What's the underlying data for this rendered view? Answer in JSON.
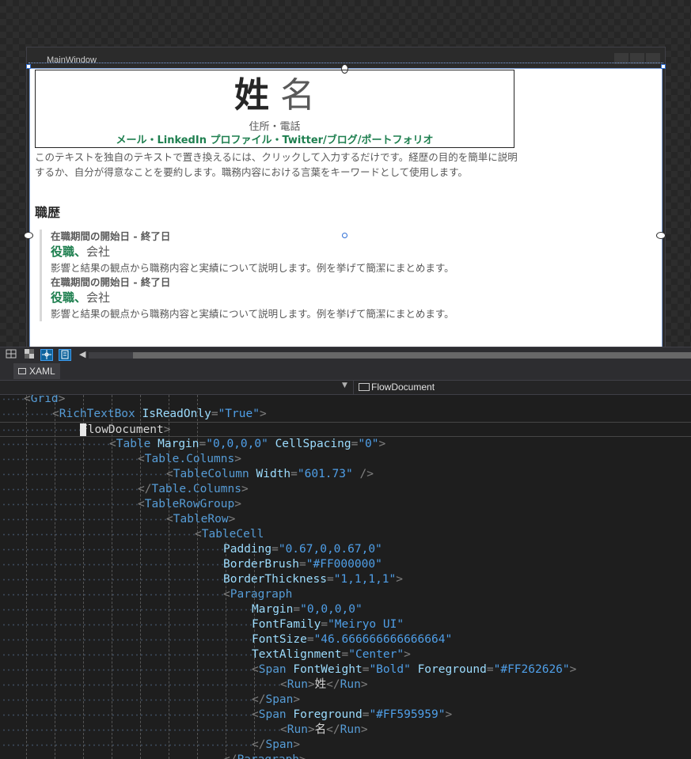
{
  "designer": {
    "window_title": "MainWindow",
    "last_name": "姓",
    "first_name": "名",
    "address": "住所・電話",
    "contact": "メール・LinkedIn プロファイル・Twitter/ブログ/ポートフォリオ",
    "summary": "このテキストを独自のテキストで置き換えるには、クリックして入力するだけです。経歴の目的を簡単に説明するか、自分が得意なことを要約します。職務内容における言葉をキーワードとして使用します。",
    "section_heading": "職歴",
    "jobs": [
      {
        "dates": "在職期間の開始日 - 終了日",
        "role": "役職、",
        "company": "会社",
        "description": "影響と結果の観点から職務内容と実績について説明します。例を挙げて簡潔にまとめます。"
      },
      {
        "dates": "在職期間の開始日 - 終了日",
        "role": "役職、",
        "company": "会社",
        "description": "影響と結果の観点から職務内容と実績について説明します。例を挙げて簡潔にまとめます。"
      }
    ],
    "colors": {
      "name_bold": "#262626",
      "name_light": "#595959",
      "accent_green": "#1e7f4f"
    }
  },
  "zoombar": {
    "icons": [
      "grid-toggle-icon",
      "checker-background-icon",
      "snap-lines-icon",
      "snap-grid-icon"
    ]
  },
  "tabs": {
    "xaml_label": "XAML"
  },
  "navbar": {
    "element_label": "FlowDocument"
  },
  "editor": {
    "lines": [
      {
        "indent": 1,
        "tokens": [
          [
            "p",
            "<"
          ],
          [
            "t",
            "Grid"
          ],
          [
            "p",
            ">"
          ]
        ]
      },
      {
        "indent": 2,
        "tokens": [
          [
            "p",
            "<"
          ],
          [
            "t",
            "RichTextBox"
          ],
          [
            "x",
            " "
          ],
          [
            "a",
            "IsReadOnly"
          ],
          [
            "p",
            "="
          ],
          [
            "v",
            "\"True\""
          ],
          [
            "p",
            ">"
          ]
        ]
      },
      {
        "indent": 3,
        "tokens": [
          [
            "x",
            "FlowDocument"
          ],
          [
            "p",
            ">"
          ]
        ]
      },
      {
        "indent": 4,
        "tokens": [
          [
            "p",
            "<"
          ],
          [
            "t",
            "Table"
          ],
          [
            "x",
            " "
          ],
          [
            "a",
            "Margin"
          ],
          [
            "p",
            "="
          ],
          [
            "v",
            "\"0,0,0,0\""
          ],
          [
            "x",
            " "
          ],
          [
            "a",
            "CellSpacing"
          ],
          [
            "p",
            "="
          ],
          [
            "v",
            "\"0\""
          ],
          [
            "p",
            ">"
          ]
        ]
      },
      {
        "indent": 5,
        "tokens": [
          [
            "p",
            "<"
          ],
          [
            "t",
            "Table.Columns"
          ],
          [
            "p",
            ">"
          ]
        ]
      },
      {
        "indent": 6,
        "tokens": [
          [
            "p",
            "<"
          ],
          [
            "t",
            "TableColumn"
          ],
          [
            "x",
            " "
          ],
          [
            "a",
            "Width"
          ],
          [
            "p",
            "="
          ],
          [
            "v",
            "\"601.73\""
          ],
          [
            "x",
            " "
          ],
          [
            "p",
            "/>"
          ]
        ]
      },
      {
        "indent": 5,
        "tokens": [
          [
            "p",
            "</"
          ],
          [
            "t",
            "Table.Columns"
          ],
          [
            "p",
            ">"
          ]
        ]
      },
      {
        "indent": 5,
        "tokens": [
          [
            "p",
            "<"
          ],
          [
            "t",
            "TableRowGroup"
          ],
          [
            "p",
            ">"
          ]
        ]
      },
      {
        "indent": 6,
        "tokens": [
          [
            "p",
            "<"
          ],
          [
            "t",
            "TableRow"
          ],
          [
            "p",
            ">"
          ]
        ]
      },
      {
        "indent": 7,
        "tokens": [
          [
            "p",
            "<"
          ],
          [
            "t",
            "TableCell"
          ]
        ]
      },
      {
        "indent": 8,
        "tokens": [
          [
            "a",
            "Padding"
          ],
          [
            "p",
            "="
          ],
          [
            "v",
            "\"0.67,0,0.67,0\""
          ]
        ]
      },
      {
        "indent": 8,
        "tokens": [
          [
            "a",
            "BorderBrush"
          ],
          [
            "p",
            "="
          ],
          [
            "v",
            "\"#FF000000\""
          ]
        ]
      },
      {
        "indent": 8,
        "tokens": [
          [
            "a",
            "BorderThickness"
          ],
          [
            "p",
            "="
          ],
          [
            "v",
            "\"1,1,1,1\""
          ],
          [
            "p",
            ">"
          ]
        ]
      },
      {
        "indent": 8,
        "tokens": [
          [
            "p",
            "<"
          ],
          [
            "t",
            "Paragraph"
          ]
        ]
      },
      {
        "indent": 9,
        "tokens": [
          [
            "a",
            "Margin"
          ],
          [
            "p",
            "="
          ],
          [
            "v",
            "\"0,0,0,0\""
          ]
        ]
      },
      {
        "indent": 9,
        "tokens": [
          [
            "a",
            "FontFamily"
          ],
          [
            "p",
            "="
          ],
          [
            "v",
            "\"Meiryo UI\""
          ]
        ]
      },
      {
        "indent": 9,
        "tokens": [
          [
            "a",
            "FontSize"
          ],
          [
            "p",
            "="
          ],
          [
            "v",
            "\"46.666666666666664\""
          ]
        ]
      },
      {
        "indent": 9,
        "tokens": [
          [
            "a",
            "TextAlignment"
          ],
          [
            "p",
            "="
          ],
          [
            "v",
            "\"Center\""
          ],
          [
            "p",
            ">"
          ]
        ]
      },
      {
        "indent": 9,
        "tokens": [
          [
            "p",
            "<"
          ],
          [
            "t",
            "Span"
          ],
          [
            "x",
            " "
          ],
          [
            "a",
            "FontWeight"
          ],
          [
            "p",
            "="
          ],
          [
            "v",
            "\"Bold\""
          ],
          [
            "x",
            " "
          ],
          [
            "a",
            "Foreground"
          ],
          [
            "p",
            "="
          ],
          [
            "v",
            "\"#FF262626\""
          ],
          [
            "p",
            ">"
          ]
        ]
      },
      {
        "indent": 10,
        "tokens": [
          [
            "p",
            "<"
          ],
          [
            "t",
            "Run"
          ],
          [
            "p",
            ">"
          ],
          [
            "x",
            "姓"
          ],
          [
            "p",
            "</"
          ],
          [
            "t",
            "Run"
          ],
          [
            "p",
            ">"
          ]
        ]
      },
      {
        "indent": 9,
        "tokens": [
          [
            "p",
            "</"
          ],
          [
            "t",
            "Span"
          ],
          [
            "p",
            ">"
          ]
        ]
      },
      {
        "indent": 9,
        "tokens": [
          [
            "p",
            "<"
          ],
          [
            "t",
            "Span"
          ],
          [
            "x",
            " "
          ],
          [
            "a",
            "Foreground"
          ],
          [
            "p",
            "="
          ],
          [
            "v",
            "\"#FF595959\""
          ],
          [
            "p",
            ">"
          ]
        ]
      },
      {
        "indent": 10,
        "tokens": [
          [
            "p",
            "<"
          ],
          [
            "t",
            "Run"
          ],
          [
            "p",
            ">"
          ],
          [
            "x",
            "名"
          ],
          [
            "p",
            "</"
          ],
          [
            "t",
            "Run"
          ],
          [
            "p",
            ">"
          ]
        ]
      },
      {
        "indent": 9,
        "tokens": [
          [
            "p",
            "</"
          ],
          [
            "t",
            "Span"
          ],
          [
            "p",
            ">"
          ]
        ]
      },
      {
        "indent": 8,
        "tokens": [
          [
            "p",
            "</"
          ],
          [
            "t",
            "Paragraph"
          ],
          [
            "p",
            ">"
          ]
        ]
      }
    ]
  }
}
